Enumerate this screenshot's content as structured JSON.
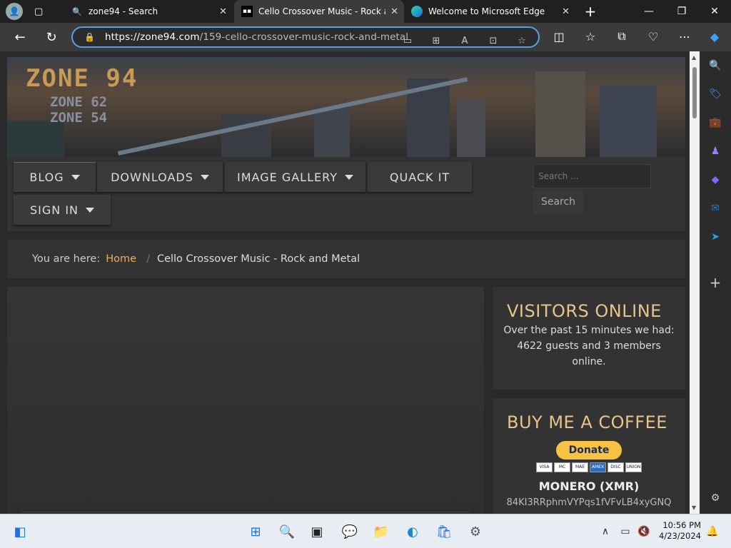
{
  "browser": {
    "tabs": [
      {
        "title": "zone94 - Search",
        "active": false
      },
      {
        "title": "Cello Crossover Music - Rock and",
        "active": true
      },
      {
        "title": "Welcome to Microsoft Edge",
        "active": false
      }
    ],
    "url_domain": "https://zone94.com",
    "url_path": "/159-cello-crossover-music-rock-and-metal"
  },
  "site": {
    "logo_main": "ZONE 94",
    "logo_sub1": "ZONE 62",
    "logo_sub2": "ZONE 54",
    "menu": [
      {
        "label": "BLOG",
        "caret": true
      },
      {
        "label": "DOWNLOADS",
        "caret": true
      },
      {
        "label": "IMAGE GALLERY",
        "caret": true
      },
      {
        "label": "QUACK IT",
        "caret": false
      },
      {
        "label": "SIGN IN",
        "caret": true
      }
    ],
    "search_placeholder": "Search ...",
    "search_button": "Search"
  },
  "breadcrumb": {
    "prefix": "You are here:",
    "home": "Home",
    "current": "Cello Crossover Music - Rock and Metal"
  },
  "visitors": {
    "title": "VISITORS ONLINE",
    "text": "Over the past 15 minutes we had: 4622 guests and 3 members online."
  },
  "coffee": {
    "title": "BUY ME A COFFEE",
    "donate": "Donate",
    "cards": [
      "VISA",
      "MC",
      "MAE",
      "AMEX",
      "DISC",
      "UNION"
    ],
    "xmr_label": "MONERO (XMR)",
    "xmr_address": "84KI3RRphmVYPqs1fVFvLB4xyGNQ"
  },
  "taskbar": {
    "time": "10:56 PM",
    "date": "4/23/2024"
  }
}
